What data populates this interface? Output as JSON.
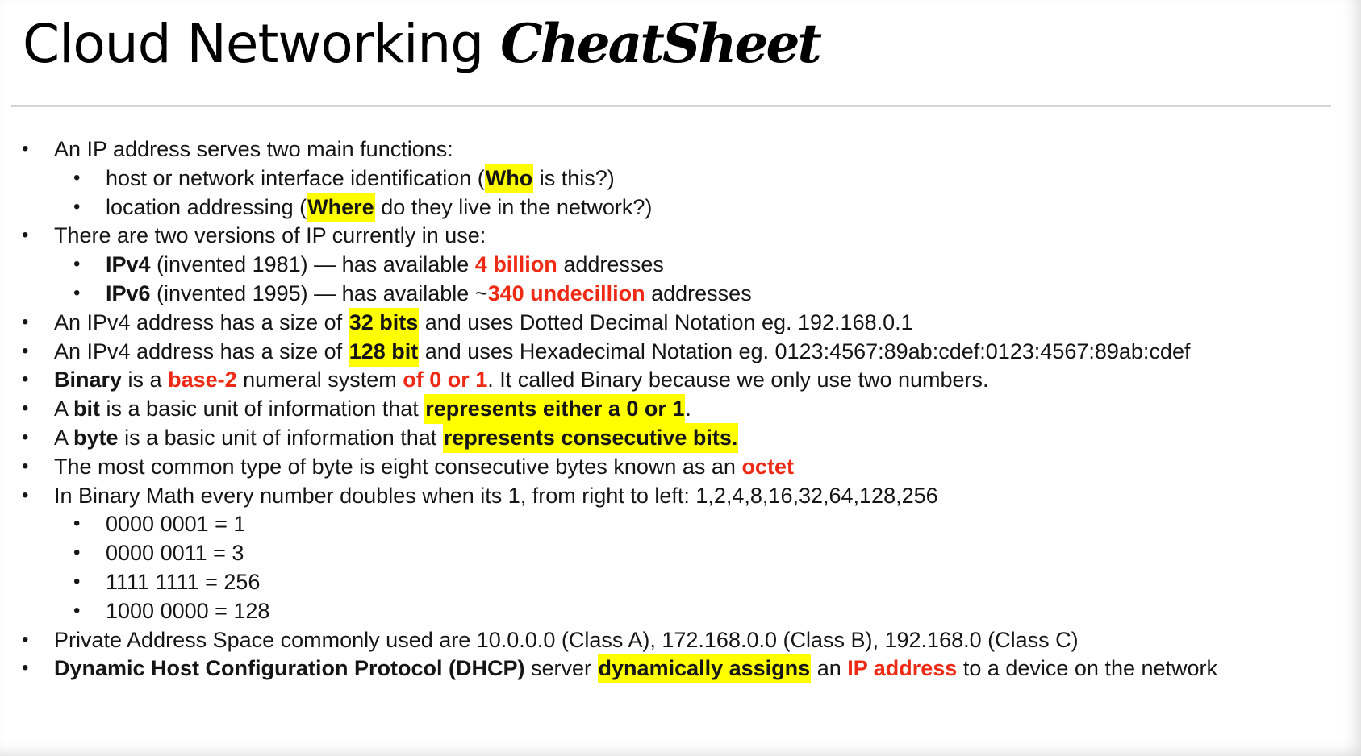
{
  "document": {
    "title_regular": "Cloud Networking",
    "title_bold": "CheatSheet"
  },
  "bullet_glyph": "•",
  "colors": {
    "highlight": "#ffff00",
    "emphasis_red": "#ee2a15",
    "rule": "#d4d4d4"
  },
  "items": [
    {
      "segments": [
        {
          "text": "An IP address serves two main functions:",
          "style": "plain"
        }
      ]
    },
    {
      "segments": [
        {
          "text": "host or network interface identification  (",
          "style": "plain"
        },
        {
          "text": "Who",
          "style": "highlight"
        },
        {
          "text": " is this?)",
          "style": "plain"
        }
      ]
    },
    {
      "segments": [
        {
          "text": "location addressing (",
          "style": "plain"
        },
        {
          "text": "Where",
          "style": "highlight"
        },
        {
          "text": " do they live in the network?)",
          "style": "plain"
        }
      ]
    },
    {
      "segments": [
        {
          "text": "There are two versions of IP currently in use:",
          "style": "plain"
        }
      ]
    },
    {
      "segments": [
        {
          "text": "IPv4",
          "style": "bold"
        },
        {
          "text": " (invented 1981) — has available ",
          "style": "plain"
        },
        {
          "text": "4 billion",
          "style": "red"
        },
        {
          "text": " addresses",
          "style": "plain"
        }
      ]
    },
    {
      "segments": [
        {
          "text": "IPv6",
          "style": "bold"
        },
        {
          "text": " (invented 1995) — has available  ~",
          "style": "plain"
        },
        {
          "text": "340 undecillion",
          "style": "red"
        },
        {
          "text": " addresses",
          "style": "plain"
        }
      ]
    },
    {
      "segments": [
        {
          "text": "An IPv4 address has a size of ",
          "style": "plain"
        },
        {
          "text": "32 bits",
          "style": "highlight"
        },
        {
          "text": " and uses Dotted Decimal Notation eg. 192.168.0.1",
          "style": "plain"
        }
      ]
    },
    {
      "segments": [
        {
          "text": "An IPv4 address has a size of ",
          "style": "plain"
        },
        {
          "text": "128 bit",
          "style": "highlight"
        },
        {
          "text": " and uses Hexadecimal Notation eg. 0123:4567:89ab:cdef:0123:4567:89ab:cdef",
          "style": "plain"
        }
      ]
    },
    {
      "segments": [
        {
          "text": "Binary",
          "style": "bold"
        },
        {
          "text": " is a ",
          "style": "plain"
        },
        {
          "text": "base-2",
          "style": "red"
        },
        {
          "text": " numeral system ",
          "style": "plain"
        },
        {
          "text": "of 0 or 1",
          "style": "red"
        },
        {
          "text": ". It called Binary because we only use two numbers.",
          "style": "plain"
        }
      ]
    },
    {
      "segments": [
        {
          "text": "A ",
          "style": "plain"
        },
        {
          "text": "bit",
          "style": "bold"
        },
        {
          "text": " is a basic unit of information that ",
          "style": "plain"
        },
        {
          "text": "represents either a 0 or 1",
          "style": "highlight"
        },
        {
          "text": ".",
          "style": "plain"
        }
      ]
    },
    {
      "segments": [
        {
          "text": "A ",
          "style": "plain"
        },
        {
          "text": "byte",
          "style": "bold"
        },
        {
          "text": " is a basic unit of information that ",
          "style": "plain"
        },
        {
          "text": "represents consecutive bits.",
          "style": "highlight"
        }
      ]
    },
    {
      "segments": [
        {
          "text": "The most common type of byte is eight consecutive bytes known as an ",
          "style": "plain"
        },
        {
          "text": "octet",
          "style": "red"
        }
      ]
    },
    {
      "segments": [
        {
          "text": "In Binary Math every number doubles when its 1, from right to left: 1,2,4,8,16,32,64,128,256",
          "style": "plain"
        }
      ]
    },
    {
      "segments": [
        {
          "text": "0000 0001 = 1",
          "style": "plain"
        }
      ]
    },
    {
      "segments": [
        {
          "text": "0000 0011 = 3",
          "style": "plain"
        }
      ]
    },
    {
      "segments": [
        {
          "text": "1111 1111 = 256",
          "style": "plain"
        }
      ]
    },
    {
      "segments": [
        {
          "text": "1000 0000 = 128",
          "style": "plain"
        }
      ]
    },
    {
      "segments": [
        {
          "text": "Private Address Space commonly used are  10.0.0.0 (Class A), 172.168.0.0 (Class B), 192.168.0 (Class C)",
          "style": "plain"
        }
      ]
    },
    {
      "segments": [
        {
          "text": "Dynamic Host Configuration Protocol (DHCP)",
          "style": "bold"
        },
        {
          "text": " server ",
          "style": "plain"
        },
        {
          "text": "dynamically assigns",
          "style": "highlight"
        },
        {
          "text": " an ",
          "style": "plain"
        },
        {
          "text": "IP address",
          "style": "red"
        },
        {
          "text": " to a device on the network",
          "style": "plain"
        }
      ]
    }
  ]
}
